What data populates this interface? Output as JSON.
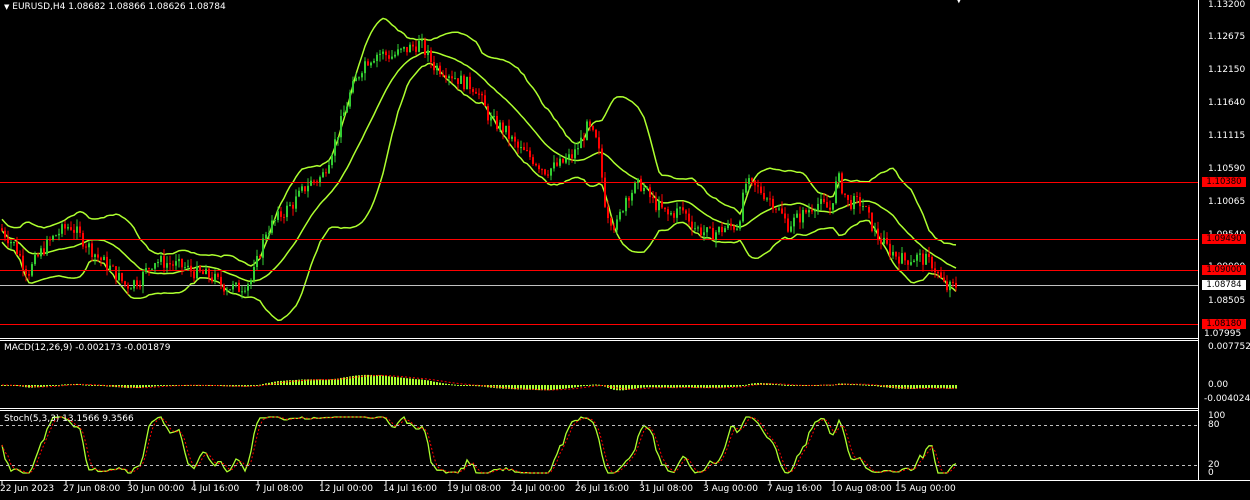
{
  "header": {
    "symbol": "EURUSD,H4",
    "ohlc": "1.08682 1.08866 1.08626 1.08784"
  },
  "colors": {
    "background": "#000000",
    "bull": "#32cd32",
    "bear": "#ff0000",
    "bands": "#adff2f",
    "level_line": "#ff0000",
    "current_line": "#c0c0c0",
    "macd_hist": "#adff2f",
    "signal": "#ff0000",
    "axis": "#ffffff"
  },
  "icons": {
    "collapse": "triangle-down-icon",
    "scroll": "scroll-marker-icon"
  },
  "chart_data": [
    {
      "type": "candlestick",
      "title": "EURUSD,H4",
      "ylim": [
        1.07995,
        1.132
      ],
      "yticks": [
        "1.13200",
        "1.12675",
        "1.12150",
        "1.11640",
        "1.11115",
        "1.10590",
        "1.10065",
        "1.09540",
        "1.09000",
        "1.08505",
        "1.07995"
      ],
      "xticks": [
        "22 Jun 2023",
        "27 Jun 08:00",
        "30 Jun 00:00",
        "4 Jul 16:00",
        "7 Jul 08:00",
        "12 Jul 00:00",
        "14 Jul 16:00",
        "19 Jul 08:00",
        "24 Jul 00:00",
        "26 Jul 16:00",
        "31 Jul 08:00",
        "3 Aug 00:00",
        "7 Aug 16:00",
        "10 Aug 08:00",
        "15 Aug 00:00"
      ],
      "current_price": "1.08784",
      "levels": [
        {
          "value": "1.10380",
          "label": "1.10380"
        },
        {
          "value": "1.09490",
          "label": "1.09490"
        },
        {
          "value": "1.09000",
          "label": "1.09000"
        },
        {
          "value": "1.08180",
          "label": "1.08180"
        }
      ],
      "close_path": [
        [
          0,
          1.097
        ],
        [
          14,
          1.0945
        ],
        [
          28,
          1.09
        ],
        [
          42,
          1.0935
        ],
        [
          56,
          1.096
        ],
        [
          70,
          1.0975
        ],
        [
          84,
          1.095
        ],
        [
          98,
          1.0925
        ],
        [
          112,
          1.0905
        ],
        [
          126,
          1.088
        ],
        [
          140,
          1.089
        ],
        [
          154,
          1.092
        ],
        [
          168,
          1.0915
        ],
        [
          182,
          1.091
        ],
        [
          196,
          1.09
        ],
        [
          210,
          1.0895
        ],
        [
          224,
          1.088
        ],
        [
          238,
          1.0875
        ],
        [
          252,
          1.089
        ],
        [
          266,
          1.0965
        ],
        [
          280,
          1.099
        ],
        [
          294,
          1.101
        ],
        [
          308,
          1.104
        ],
        [
          322,
          1.105
        ],
        [
          336,
          1.111
        ],
        [
          350,
          1.118
        ],
        [
          364,
          1.123
        ],
        [
          378,
          1.1245
        ],
        [
          392,
          1.124
        ],
        [
          406,
          1.125
        ],
        [
          420,
          1.126
        ],
        [
          434,
          1.1225
        ],
        [
          448,
          1.1215
        ],
        [
          462,
          1.12
        ],
        [
          476,
          1.119
        ],
        [
          490,
          1.114
        ],
        [
          504,
          1.1125
        ],
        [
          518,
          1.1095
        ],
        [
          532,
          1.108
        ],
        [
          546,
          1.106
        ],
        [
          560,
          1.107
        ],
        [
          574,
          1.1085
        ],
        [
          588,
          1.113
        ],
        [
          598,
          1.11
        ],
        [
          606,
          1.1
        ],
        [
          616,
          1.097
        ],
        [
          626,
          1.102
        ],
        [
          640,
          1.104
        ],
        [
          654,
          1.101
        ],
        [
          668,
          1.099
        ],
        [
          682,
          1.1
        ],
        [
          696,
          1.097
        ],
        [
          710,
          1.096
        ],
        [
          724,
          1.097
        ],
        [
          738,
          1.0975
        ],
        [
          746,
          1.104
        ],
        [
          760,
          1.103
        ],
        [
          774,
          1.101
        ],
        [
          788,
          1.0975
        ],
        [
          802,
          1.099
        ],
        [
          816,
          1.101
        ],
        [
          830,
          1.1
        ],
        [
          838,
          1.105
        ],
        [
          848,
          1.101
        ],
        [
          862,
          1.101
        ],
        [
          876,
          1.096
        ],
        [
          890,
          1.0935
        ],
        [
          904,
          1.092
        ],
        [
          918,
          1.0925
        ],
        [
          932,
          1.0915
        ],
        [
          946,
          1.0875
        ],
        [
          956,
          1.088
        ]
      ]
    },
    {
      "type": "bar",
      "title": "MACD(12,26,9) -0.002173 -0.001879",
      "yticks": [
        "0.007752",
        "0.00",
        "-0.004024"
      ]
    },
    {
      "type": "line",
      "title": "Stoch(5,3,3) 13.1566 9.3566",
      "yticks": [
        "100",
        "80",
        "20",
        "0"
      ]
    }
  ]
}
